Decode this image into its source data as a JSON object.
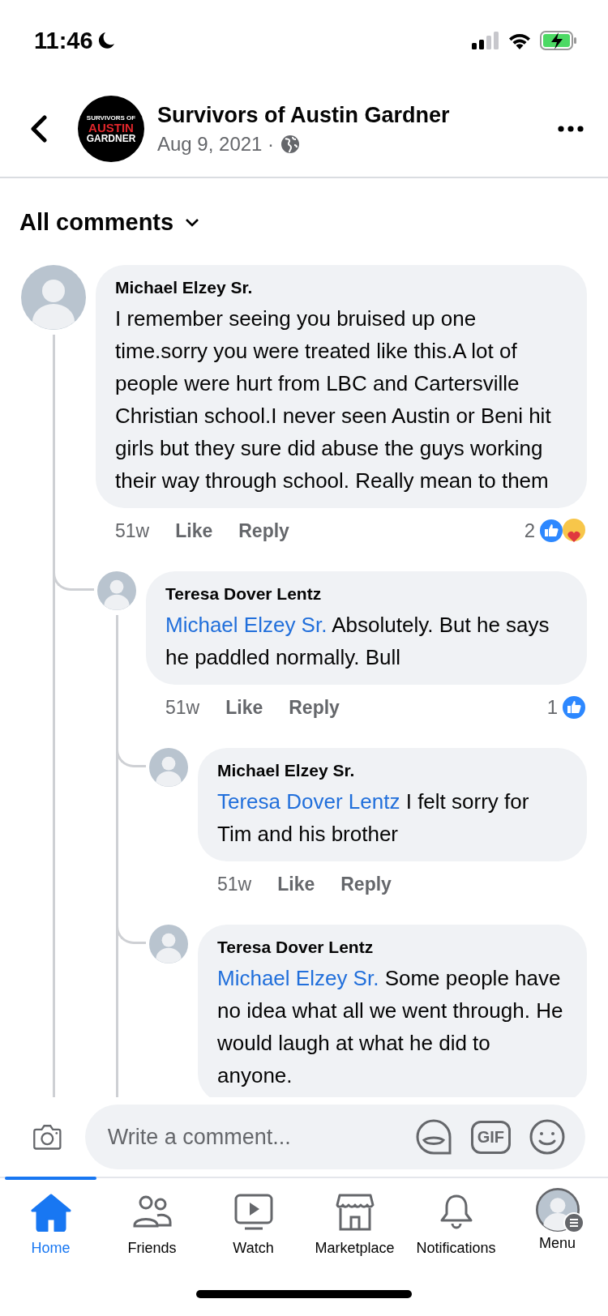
{
  "status_bar": {
    "time": "11:46"
  },
  "header": {
    "logo": {
      "lines": [
        "SURVIVORS OF",
        "AUSTIN",
        "GARDNER"
      ]
    },
    "title": "Survivors of Austin Gardner",
    "date": "Aug 9, 2021 ·"
  },
  "filter": {
    "label": "All comments"
  },
  "comments": [
    {
      "author": "Michael Elzey Sr.",
      "text": "I remember seeing you bruised up one time.sorry you were treated like this.A lot of people were hurt from LBC and Cartersville Christian school.I never seen Austin or Beni hit girls but they sure did abuse the guys working their way through school. Really mean to them",
      "time": "51w",
      "like": "Like",
      "reply": "Reply",
      "reaction_count": "2",
      "reactions": [
        {
          "kind": "like"
        },
        {
          "kind": "care"
        }
      ],
      "children": [
        {
          "author": "Teresa Dover Lentz",
          "mention": "Michael Elzey Sr.",
          "text": "Absolutely. But he says he paddled normally. Bull",
          "time": "51w",
          "like": "Like",
          "reply": "Reply",
          "reaction_count": "1",
          "reactions": [
            {
              "kind": "like"
            }
          ],
          "children": [
            {
              "author": "Michael Elzey Sr.",
              "mention": "Teresa Dover Lentz",
              "text": "I felt sorry for Tim and his brother",
              "time": "51w",
              "like": "Like",
              "reply": "Reply"
            },
            {
              "author": "Teresa Dover Lentz",
              "mention": "Michael Elzey Sr.",
              "text": "Some people have no idea what all we went through. He would laugh at what he did to anyone."
            }
          ]
        }
      ]
    }
  ],
  "composer": {
    "placeholder": "Write a comment...",
    "gif_label": "GIF"
  },
  "tabs": [
    {
      "kind": "home",
      "label": "Home",
      "selected": true
    },
    {
      "kind": "friends",
      "label": "Friends",
      "selected": false
    },
    {
      "kind": "watch",
      "label": "Watch",
      "selected": false
    },
    {
      "kind": "marketplace",
      "label": "Marketplace",
      "selected": false
    },
    {
      "kind": "notifications",
      "label": "Notifications",
      "selected": false
    },
    {
      "kind": "menu",
      "label": "Menu",
      "selected": false
    }
  ]
}
